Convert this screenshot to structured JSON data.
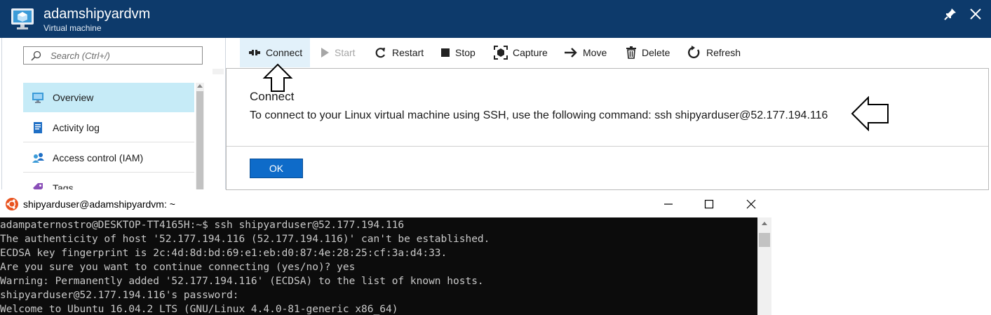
{
  "blade": {
    "title": "adamshipyardvm",
    "subtitle": "Virtual machine"
  },
  "sidebar": {
    "search_placeholder": "Search (Ctrl+/)",
    "items": [
      {
        "label": "Overview",
        "icon": "monitor-icon",
        "active": true
      },
      {
        "label": "Activity log",
        "icon": "activity-log-icon",
        "active": false
      },
      {
        "label": "Access control (IAM)",
        "icon": "users-icon",
        "active": false
      },
      {
        "label": "Tags",
        "icon": "tag-icon",
        "active": false
      }
    ]
  },
  "commands": [
    {
      "label": "Connect",
      "icon": "connect-plug-icon",
      "enabled": true
    },
    {
      "label": "Start",
      "icon": "play-icon",
      "enabled": false
    },
    {
      "label": "Restart",
      "icon": "restart-icon",
      "enabled": true
    },
    {
      "label": "Stop",
      "icon": "stop-icon",
      "enabled": true
    },
    {
      "label": "Capture",
      "icon": "capture-icon",
      "enabled": true
    },
    {
      "label": "Move",
      "icon": "arrow-right-icon",
      "enabled": true
    },
    {
      "label": "Delete",
      "icon": "trash-icon",
      "enabled": true
    },
    {
      "label": "Refresh",
      "icon": "refresh-icon",
      "enabled": true
    }
  ],
  "connect_panel": {
    "title": "Connect",
    "message": "To connect to your Linux virtual machine using SSH, use the following command: ssh shipyarduser@52.177.194.116",
    "ok_label": "OK"
  },
  "terminal": {
    "title": "shipyarduser@adamshipyardvm: ~",
    "lines": [
      "adampaternostro@DESKTOP-TT4165H:~$ ssh shipyarduser@52.177.194.116",
      "The authenticity of host '52.177.194.116 (52.177.194.116)' can't be established.",
      "ECDSA key fingerprint is 2c:4d:8d:bd:69:e1:eb:d0:87:4e:28:25:cf:3a:d4:33.",
      "Are you sure you want to continue connecting (yes/no)? yes",
      "Warning: Permanently added '52.177.194.116' (ECDSA) to the list of known hosts.",
      "shipyarduser@52.177.194.116's password:",
      "Welcome to Ubuntu 16.04.2 LTS (GNU/Linux 4.4.0-81-generic x86_64)"
    ]
  },
  "colors": {
    "header_bg": "#0d3a6b",
    "active_nav": "#c6ebf7",
    "ok_button": "#0e6bc9",
    "terminal_bg": "#0c0c0c",
    "ubuntu_orange": "#e95420"
  }
}
